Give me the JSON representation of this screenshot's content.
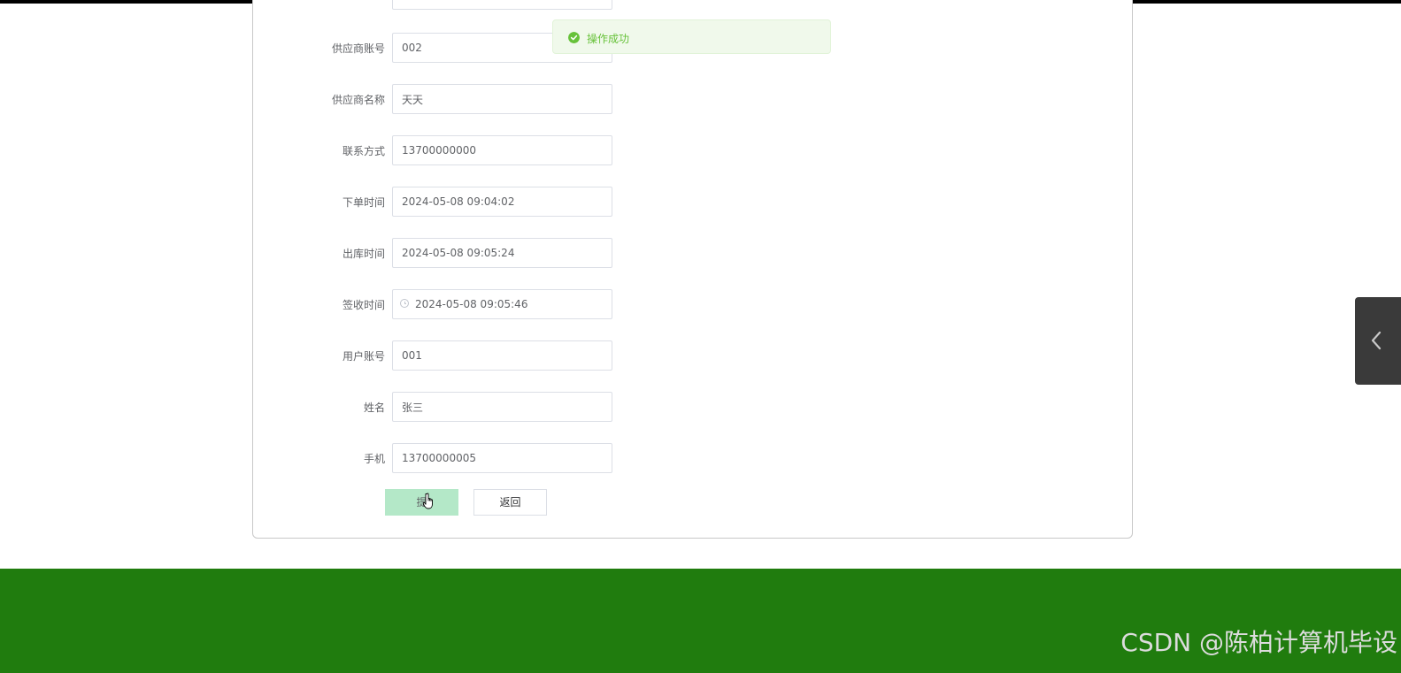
{
  "form": {
    "fields": [
      {
        "label": "",
        "value": ""
      },
      {
        "label": "供应商账号",
        "value": "002"
      },
      {
        "label": "供应商名称",
        "value": "天天"
      },
      {
        "label": "联系方式",
        "value": "13700000000"
      },
      {
        "label": "下单时间",
        "value": "2024-05-08 09:04:02"
      },
      {
        "label": "出库时间",
        "value": "2024-05-08 09:05:24"
      },
      {
        "label": "签收时间",
        "value": "2024-05-08 09:05:46",
        "icon": "clock-icon"
      },
      {
        "label": "用户账号",
        "value": "001"
      },
      {
        "label": "姓名",
        "value": "张三"
      },
      {
        "label": "手机",
        "value": "13700000005"
      }
    ],
    "submit_label": "提",
    "back_label": "返回"
  },
  "toast": {
    "message": "操作成功",
    "icon": "check-circle-icon",
    "color": "#67c23a"
  },
  "side_tab": {
    "icon": "chevron-left-icon"
  },
  "footer": {
    "color": "#207c0e",
    "watermark": "CSDN @陈柏计算机毕设"
  }
}
